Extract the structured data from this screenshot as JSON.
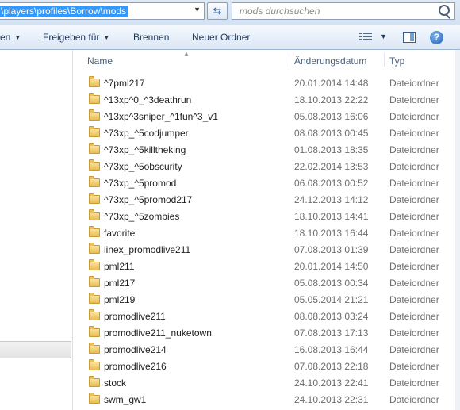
{
  "address_bar": {
    "path": "\\players\\profiles\\Borrow\\mods"
  },
  "search": {
    "placeholder": "mods durchsuchen"
  },
  "command_bar": {
    "organize_partial": "en",
    "share_with": "Freigeben für",
    "burn": "Brennen",
    "new_folder": "Neuer Ordner"
  },
  "columns": {
    "name": "Name",
    "date": "Änderungsdatum",
    "type": "Typ"
  },
  "files": [
    {
      "name": "^7pml217",
      "date": "20.01.2014 14:48",
      "type": "Dateiordner"
    },
    {
      "name": "^13xp^0_^3deathrun",
      "date": "18.10.2013 22:22",
      "type": "Dateiordner"
    },
    {
      "name": "^13xp^3sniper_^1fun^3_v1",
      "date": "05.08.2013 16:06",
      "type": "Dateiordner"
    },
    {
      "name": "^73xp_^5codjumper",
      "date": "08.08.2013 00:45",
      "type": "Dateiordner"
    },
    {
      "name": "^73xp_^5killtheking",
      "date": "01.08.2013 18:35",
      "type": "Dateiordner"
    },
    {
      "name": "^73xp_^5obscurity",
      "date": "22.02.2014 13:53",
      "type": "Dateiordner"
    },
    {
      "name": "^73xp_^5promod",
      "date": "06.08.2013 00:52",
      "type": "Dateiordner"
    },
    {
      "name": "^73xp_^5promod217",
      "date": "24.12.2013 14:12",
      "type": "Dateiordner"
    },
    {
      "name": "^73xp_^5zombies",
      "date": "18.10.2013 14:41",
      "type": "Dateiordner"
    },
    {
      "name": "favorite",
      "date": "18.10.2013 16:44",
      "type": "Dateiordner"
    },
    {
      "name": "linex_promodlive211",
      "date": "07.08.2013 01:39",
      "type": "Dateiordner"
    },
    {
      "name": "pml211",
      "date": "20.01.2014 14:50",
      "type": "Dateiordner"
    },
    {
      "name": "pml217",
      "date": "05.08.2013 00:34",
      "type": "Dateiordner"
    },
    {
      "name": "pml219",
      "date": "05.05.2014 21:21",
      "type": "Dateiordner"
    },
    {
      "name": "promodlive211",
      "date": "08.08.2013 03:24",
      "type": "Dateiordner"
    },
    {
      "name": "promodlive211_nuketown",
      "date": "07.08.2013 17:13",
      "type": "Dateiordner"
    },
    {
      "name": "promodlive214",
      "date": "16.08.2013 16:44",
      "type": "Dateiordner"
    },
    {
      "name": "promodlive216",
      "date": "07.08.2013 22:18",
      "type": "Dateiordner"
    },
    {
      "name": "stock",
      "date": "24.10.2013 22:41",
      "type": "Dateiordner"
    },
    {
      "name": "swm_gw1",
      "date": "24.10.2013 22:31",
      "type": "Dateiordner"
    }
  ]
}
